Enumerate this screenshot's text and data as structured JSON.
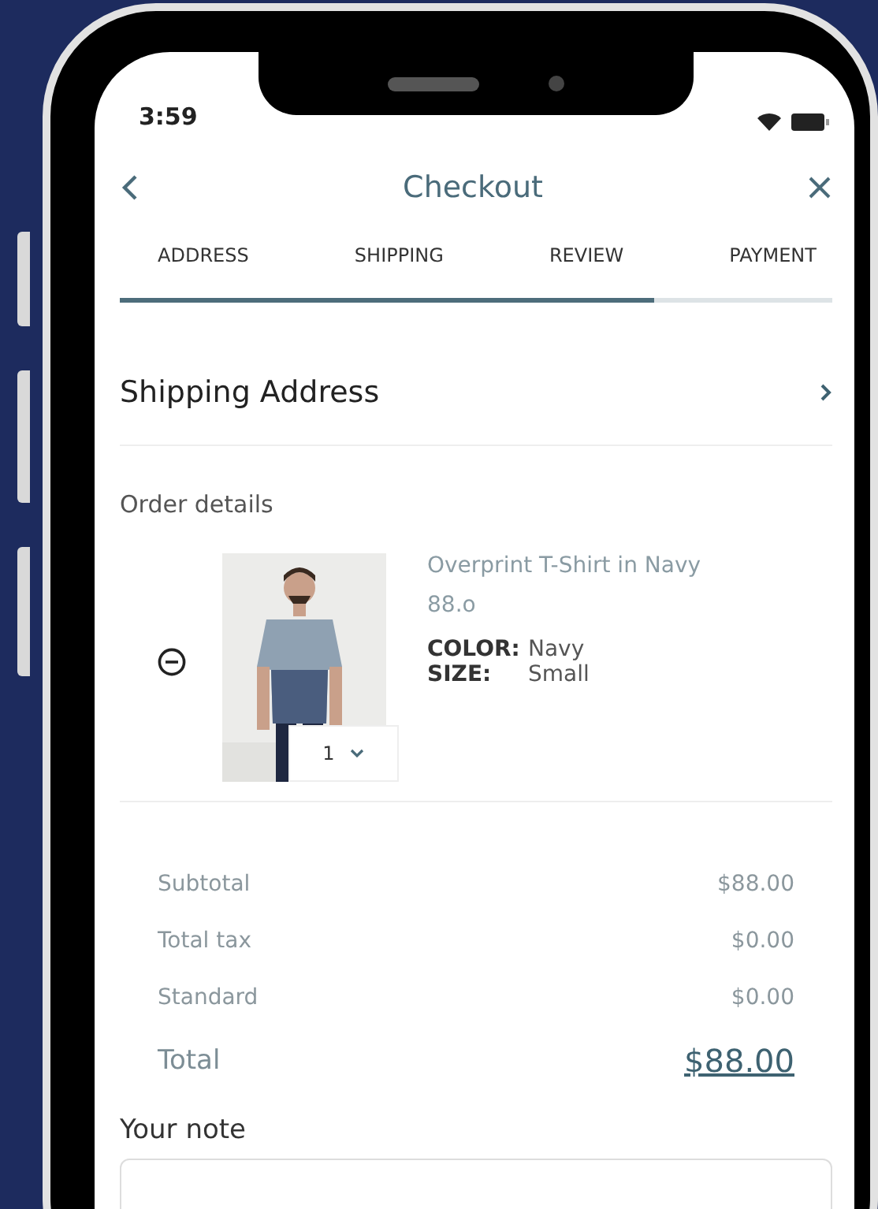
{
  "status_bar": {
    "time": "3:59"
  },
  "header": {
    "title": "Checkout"
  },
  "steps": {
    "tabs": [
      {
        "label": "ADDRESS"
      },
      {
        "label": "SHIPPING"
      },
      {
        "label": "REVIEW"
      },
      {
        "label": "PAYMENT"
      }
    ],
    "level": 0.75
  },
  "shipping_address": {
    "label": "Shipping Address"
  },
  "order": {
    "heading": "Order details",
    "items": [
      {
        "name": "Overprint T-Shirt in Navy",
        "price": "88.o",
        "color_label": "COLOR:",
        "color_value": "Navy",
        "size_label": "SIZE:",
        "size": "Small",
        "quantity": "1"
      }
    ]
  },
  "summary": {
    "rows": [
      {
        "label": "Subtotal",
        "value": "$88.00"
      },
      {
        "label": "Total tax",
        "value": "$0.00"
      },
      {
        "label": "Standard",
        "value": "$0.00"
      }
    ],
    "total_label": "Total",
    "total_value": "$88.00"
  },
  "note": {
    "label": "Your note"
  }
}
